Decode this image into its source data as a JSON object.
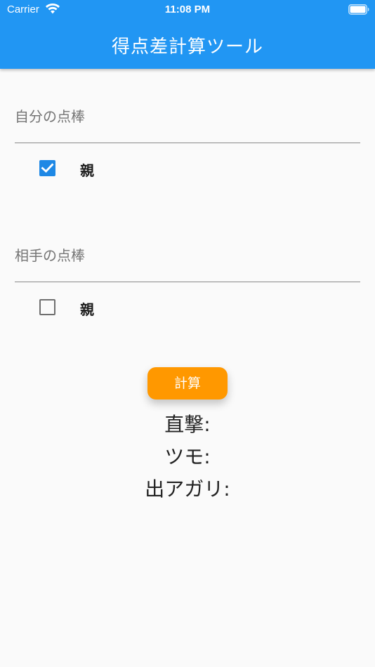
{
  "status_bar": {
    "carrier": "Carrier",
    "time": "11:08 PM",
    "wifi_icon": "wifi-icon",
    "battery_icon": "battery-full-icon"
  },
  "app_bar": {
    "title": "得点差計算ツール",
    "color": "#2196f3"
  },
  "self_section": {
    "placeholder": "自分の点棒",
    "value": "",
    "dealer_checkbox": {
      "label": "親",
      "checked": true
    }
  },
  "opponent_section": {
    "placeholder": "相手の点棒",
    "value": "",
    "dealer_checkbox": {
      "label": "親",
      "checked": false
    }
  },
  "calculate_button": {
    "label": "計算",
    "color": "#ff9800"
  },
  "results": {
    "direct_hit": "直撃:",
    "tsumo": "ツモ:",
    "deal_in": "出アガリ:"
  }
}
